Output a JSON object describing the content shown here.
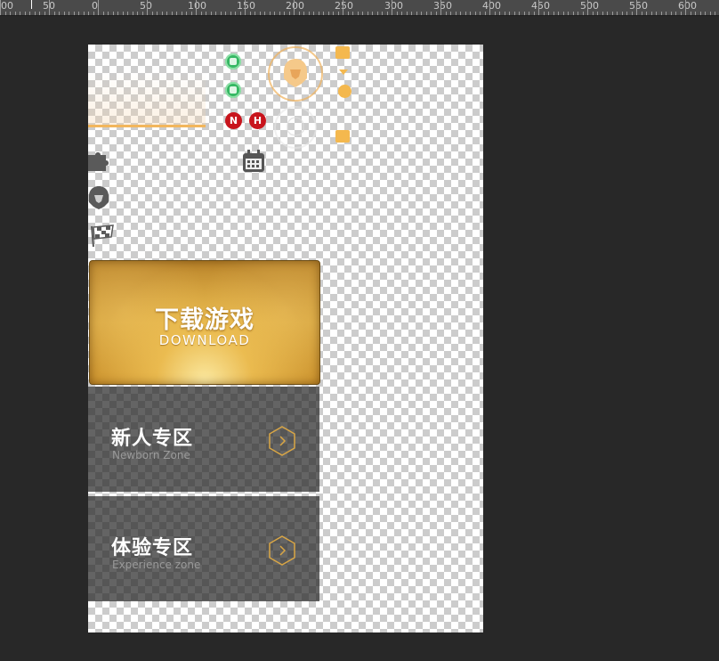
{
  "ruler": {
    "labels": [
      "00",
      "50",
      "0",
      "50",
      "100",
      "150",
      "200",
      "250",
      "300",
      "350",
      "400",
      "450",
      "500",
      "550",
      "600"
    ]
  },
  "canvas": {
    "badges": {
      "n_label": "N",
      "h_label": "H"
    },
    "download_banner": {
      "title": "下载游戏",
      "subtitle": "DOWNLOAD"
    },
    "zones": [
      {
        "title": "新人专区",
        "subtitle": "Newborn Zone"
      },
      {
        "title": "体验专区",
        "subtitle": "Experience zone"
      }
    ]
  },
  "colors": {
    "app_background": "#282828",
    "accent_gold": "#f4b84e",
    "badge_red": "#c8141c",
    "badge_green": "#36b864"
  },
  "icons": [
    "puzzle-icon",
    "helmet-icon",
    "checkered-flag-icon",
    "calendar-icon",
    "lock-icon",
    "clock-icon",
    "yen-icon",
    "chevron-right-icon"
  ]
}
